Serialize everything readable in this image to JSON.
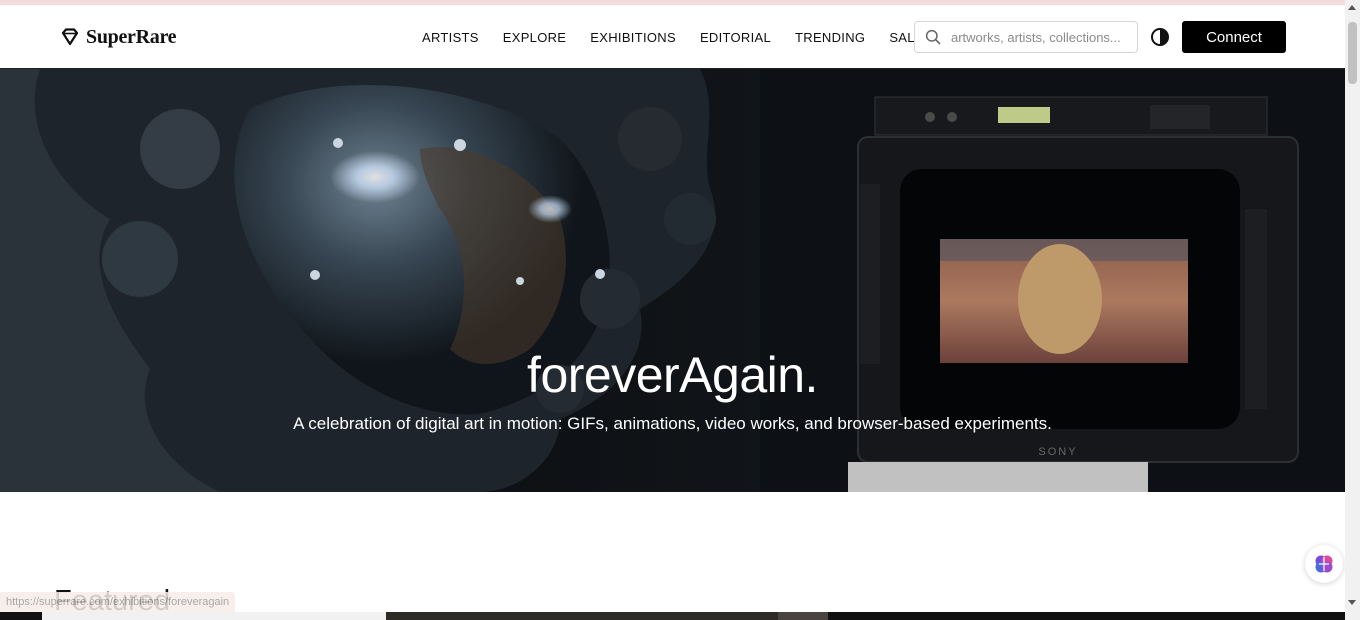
{
  "brand": {
    "name": "SuperRare",
    "logo_icon": "diamond-icon"
  },
  "nav": {
    "items": [
      {
        "label": "ARTISTS"
      },
      {
        "label": "EXPLORE"
      },
      {
        "label": "EXHIBITIONS"
      },
      {
        "label": "EDITORIAL"
      },
      {
        "label": "TRENDING"
      },
      {
        "label": "SALES"
      }
    ]
  },
  "search": {
    "placeholder": "artworks, artists, collections...",
    "icon": "search-icon"
  },
  "theme_toggle": {
    "icon": "contrast-icon"
  },
  "connect": {
    "label": "Connect"
  },
  "hero": {
    "title": "foreverAgain.",
    "subtitle": "A celebration of digital art in motion: GIFs, animations, video works, and browser-based experiments.",
    "tv_brand": "SONY"
  },
  "featured": {
    "heading": "Featured"
  },
  "status_bar": {
    "url": "https://superrare.com/exhibitions/foreveragain"
  },
  "colors": {
    "primary_button": "#000000",
    "hero_background": "#07090c",
    "text": "#111111"
  }
}
